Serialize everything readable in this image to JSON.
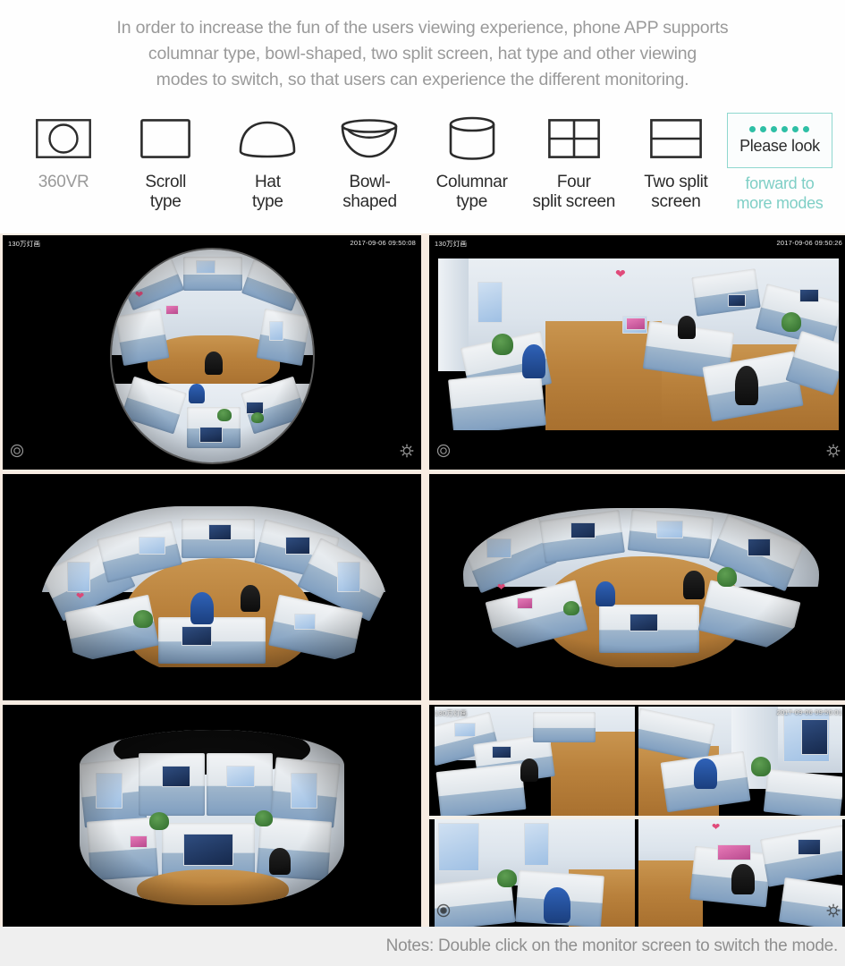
{
  "intro": {
    "lines": [
      "In order to increase the fun of the users viewing experience, phone APP supports",
      "columnar type, bowl-shaped, two split screen, hat type and other viewing",
      "modes to switch, so that users can experience the different monitoring."
    ]
  },
  "modes": [
    {
      "icon": "360vr-icon",
      "label": "360VR",
      "dim": true
    },
    {
      "icon": "scroll-type-icon",
      "label": "Scroll\ntype",
      "dim": false
    },
    {
      "icon": "hat-type-icon",
      "label": "Hat\ntype",
      "dim": false
    },
    {
      "icon": "bowl-shaped-icon",
      "label": "Bowl-\nshaped",
      "dim": false
    },
    {
      "icon": "columnar-type-icon",
      "label": "Columnar\ntype",
      "dim": false
    },
    {
      "icon": "four-split-screen-icon",
      "label": "Four\nsplit screen",
      "dim": false
    },
    {
      "icon": "two-split-screen-icon",
      "label": "Two split\nscreen",
      "dim": false
    }
  ],
  "teaser": {
    "dot_count": 6,
    "dot_color": "#2ebfa5",
    "border_color": "#8fd8cf",
    "main_text": "Please look",
    "sub_text": "forward to\nmore modes",
    "sub_color": "#7fcfc6"
  },
  "panels": [
    {
      "id": "panel-360vr",
      "mode": "360VR",
      "osd_left": "130万灯画",
      "osd_right": "2017-09-06 09:50:08",
      "ctl_left_icon": "compass-icon",
      "ctl_right_icon": "gear-icon"
    },
    {
      "id": "panel-scroll-type",
      "mode": "Scroll type",
      "osd_left": "130万灯画",
      "osd_right": "2017-09-06 09:50:26",
      "ctl_left_icon": "compass-icon",
      "ctl_right_icon": "gear-icon"
    },
    {
      "id": "panel-hat-type",
      "mode": "Hat type",
      "osd_left": "",
      "osd_right": "",
      "ctl_left_icon": "",
      "ctl_right_icon": ""
    },
    {
      "id": "panel-bowl-shaped",
      "mode": "Bowl-shaped",
      "osd_left": "",
      "osd_right": "",
      "ctl_left_icon": "",
      "ctl_right_icon": ""
    },
    {
      "id": "panel-columnar-type",
      "mode": "Columnar type",
      "osd_left": "",
      "osd_right": "",
      "ctl_left_icon": "",
      "ctl_right_icon": ""
    },
    {
      "id": "panel-four-split-screen",
      "mode": "Four split screen",
      "osd_left": "130万灯画",
      "osd_right": "2017-09-06 09:50:01",
      "ctl_left_icon": "compass-icon",
      "ctl_right_icon": "gear-icon"
    }
  ],
  "footer": {
    "note": "Notes: Double click on the monitor screen to switch the mode."
  },
  "colors": {
    "page_background": "#fdfdfd",
    "grid_gap": "#f7ece2",
    "footer_background": "#efefef",
    "intro_text": "#9a9a9a",
    "label_text": "#2b2b2b",
    "accent_teal": "#2ebfa5"
  }
}
